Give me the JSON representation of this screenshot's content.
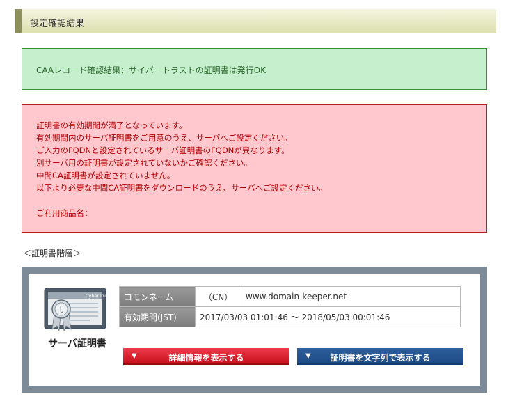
{
  "header": {
    "title": "設定確認結果"
  },
  "caa_result": {
    "message": "CAAレコード確認結果：サイバートラストの証明書は発行OK"
  },
  "errors": {
    "lines": [
      "証明書の有効期間が満了となっています。",
      "有効期間内のサーバ証明書をご用意のうえ、サーバへご設定ください。",
      "ご入力のFQDNと設定されているサーバ証明書のFQDNが異なります。",
      "別サーバ用の証明書が設定されていないかご確認ください。",
      "中間CA証明書が設定されていません。",
      "以下より必要な中間CA証明書をダウンロードのうえ、サーバへご設定ください。"
    ],
    "product_label": "ご利用商品名："
  },
  "hierarchy": {
    "label": "＜証明書階層＞"
  },
  "certificate": {
    "icon_brand": "CyberTrust",
    "icon_letter": "t",
    "caption": "サーバ証明書",
    "common_name_label": "コモンネーム",
    "common_name_tag": "（CN）",
    "common_name_value": "www.domain-keeper.net",
    "validity_label": "有効期間(JST)",
    "validity_value": "2017/03/03 01:01:46 〜 2018/05/03 00:01:46"
  },
  "buttons": {
    "details_label": "詳細情報を表示する",
    "show_text_label": "証明書を文字列で表示する",
    "arrow_icon": "▼"
  },
  "colors": {
    "ok_bg": "#c6efce",
    "error_bg": "#ffc7ce",
    "error_text": "#b00000",
    "details_button": "#d9152a",
    "text_button": "#245494"
  }
}
